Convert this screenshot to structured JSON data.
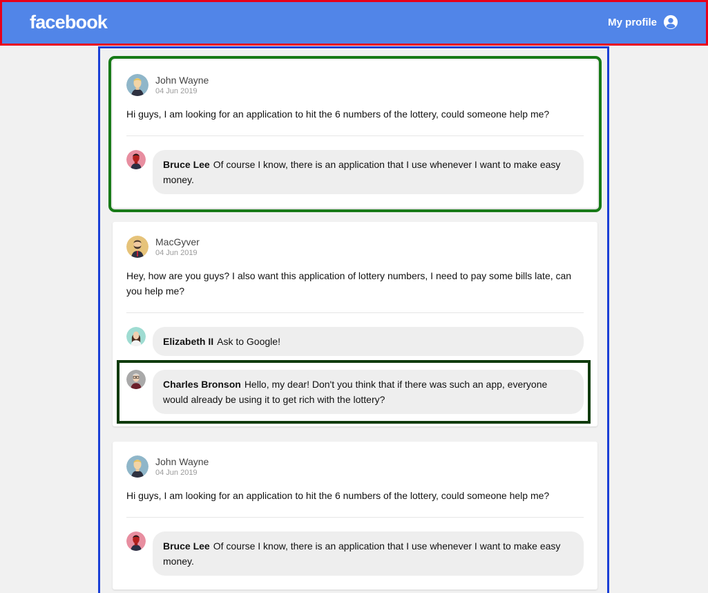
{
  "header": {
    "logo": "facebook",
    "profile_label": "My profile",
    "profile_icon": "user-circle-icon"
  },
  "colors": {
    "header_bg": "#5185e8",
    "bubble_bg": "#eeeeee",
    "page_bg": "#f1f1f1"
  },
  "posts": [
    {
      "author": "John Wayne",
      "date": "04 Jun 2019",
      "text": "Hi guys, I am looking for an application to hit the 6 numbers of the lottery, could someone help me?",
      "comments": [
        {
          "author": "Bruce Lee",
          "text": "Of course I know, there is an application that I use whenever I want to make easy money."
        }
      ]
    },
    {
      "author": "MacGyver",
      "date": "04 Jun 2019",
      "text": "Hey, how are you guys? I also want this application of lottery numbers, I need to pay some bills late, can you help me?",
      "comments": [
        {
          "author": "Elizabeth II",
          "text": "Ask to Google!"
        },
        {
          "author": "Charles Bronson",
          "text": "Hello, my dear! Don't you think that if there was such an app, everyone would already be using it to get rich with the lottery?"
        }
      ]
    },
    {
      "author": "John Wayne",
      "date": "04 Jun 2019",
      "text": "Hi guys, I am looking for an application to hit the 6 numbers of the lottery, could someone help me?",
      "comments": [
        {
          "author": "Bruce Lee",
          "text": "Of course I know, there is an application that I use whenever I want to make easy money."
        }
      ]
    }
  ]
}
